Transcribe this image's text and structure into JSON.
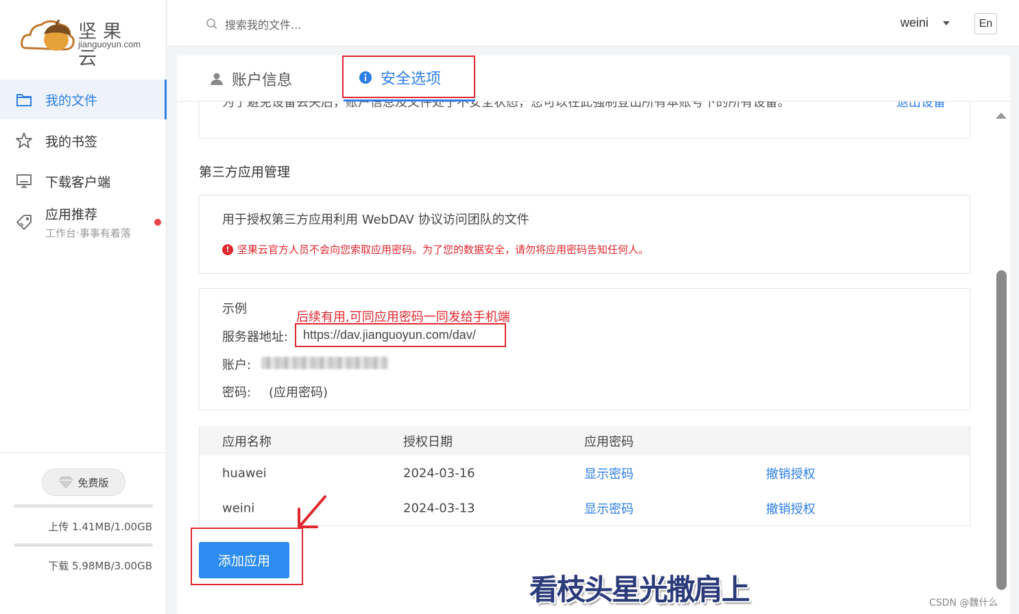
{
  "app": {
    "logo_text": "坚果云",
    "logo_domain": "jianguoyun.com"
  },
  "sidebar": {
    "items": [
      {
        "label": "我的文件",
        "icon": "folder-icon",
        "active": true
      },
      {
        "label": "我的书签",
        "icon": "star-icon",
        "active": false
      },
      {
        "label": "下载客户端",
        "icon": "monitor-icon",
        "active": false
      },
      {
        "label": "应用推荐",
        "sub": "工作台·事事有着落",
        "icon": "tag-icon",
        "active": false,
        "badge": "red-dot"
      }
    ],
    "plan_label": "免费版",
    "upload_quota": "上传 1.41MB/1.00GB",
    "upload_fraction": 0.0014,
    "download_quota": "下载 5.98MB/3.00GB",
    "download_fraction": 0.0019
  },
  "header": {
    "search_placeholder": "搜索我的文件...",
    "username": "weini",
    "lang_button": "En"
  },
  "tabs": [
    {
      "label": "账户信息",
      "icon": "user-icon",
      "active": false
    },
    {
      "label": "安全选项",
      "icon": "info-icon",
      "active": true
    }
  ],
  "devices_section": {
    "text": "为了避免设备丢失后，账户信息及文件处于不安全状态，您可以在此强制登出所有本账号下的所有设备。",
    "action_label": "退出设备"
  },
  "third_party": {
    "title": "第三方应用管理",
    "description": "用于授权第三方应用利用 WebDAV 协议访问团队的文件",
    "warning": "坚果云官方人员不会向您索取应用密码。为了您的数据安全，请勿将应用密码告知任何人。",
    "example": {
      "title": "示例",
      "annotation": "后续有用,可同应用密码一同发给手机端",
      "server_label": "服务器地址:",
      "server_url": "https://dav.jianguoyun.com/dav/",
      "account_label": "账户:",
      "password_label": "密码:",
      "password_value": "(应用密码)"
    },
    "table": {
      "headers": [
        "应用名称",
        "授权日期",
        "应用密码"
      ],
      "rows": [
        {
          "name": "huawei",
          "date": "2024-03-16",
          "show_password": "显示密码",
          "revoke": "撤销授权"
        },
        {
          "name": "weini",
          "date": "2024-03-13",
          "show_password": "显示密码",
          "revoke": "撤销授权"
        }
      ]
    },
    "add_button": "添加应用"
  },
  "overlay": {
    "caption": "看枝头星光撒肩上",
    "credit": "CSDN @魏什么"
  },
  "colors": {
    "accent": "#2d7ee8",
    "button": "#2d8cf0",
    "annotation_red": "#e0262e"
  }
}
